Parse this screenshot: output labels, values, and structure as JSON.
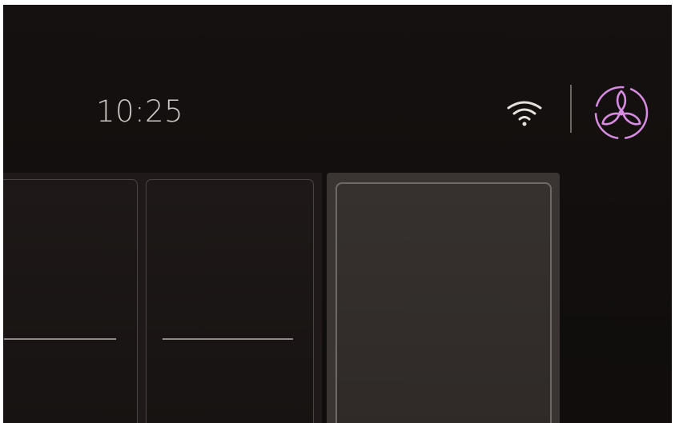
{
  "status_bar": {
    "time": "10:25",
    "wifi_icon": "wifi-icon",
    "fan_icon": "fan-icon",
    "fan_icon_color": "#d88be3"
  },
  "colors": {
    "background": "#110e0d",
    "text": "#cfcac6",
    "card_border": "#4a4442",
    "selected_card": "#36312f",
    "accent": "#d88be3"
  },
  "cards": [
    {
      "id": "card-1",
      "selected": false
    },
    {
      "id": "card-2",
      "selected": false
    },
    {
      "id": "card-3",
      "selected": true
    }
  ]
}
